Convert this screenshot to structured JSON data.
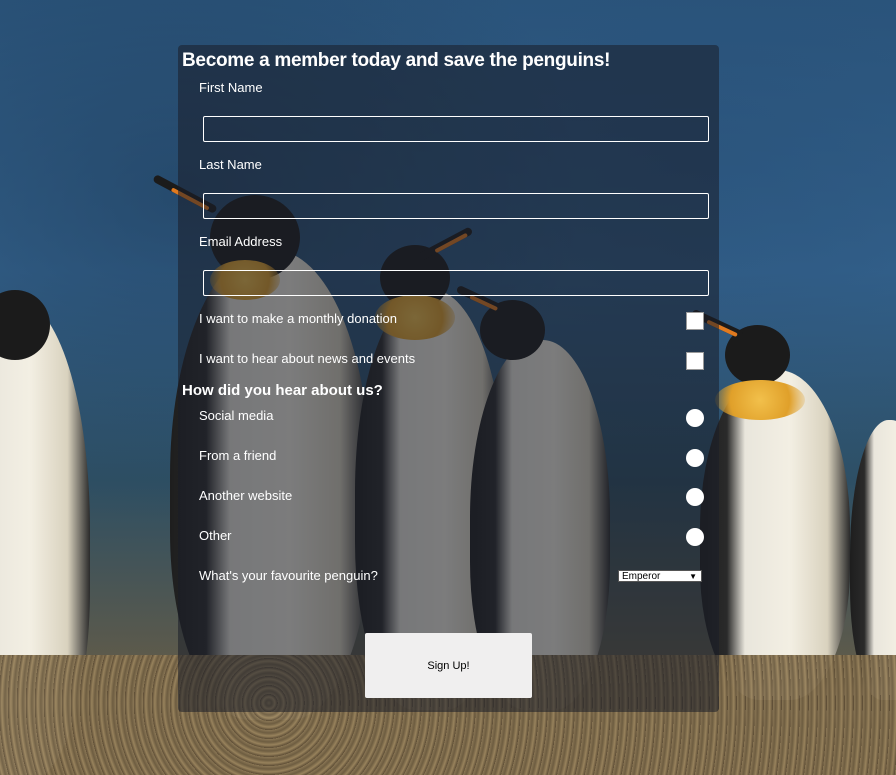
{
  "form": {
    "title": "Become a member today and save the penguins!",
    "first_name_label": "First Name",
    "first_name_value": "",
    "last_name_label": "Last Name",
    "last_name_value": "",
    "email_label": "Email Address",
    "email_value": "",
    "donation_label": "I want to make a monthly donation",
    "news_label": "I want to hear about news and events",
    "hear_heading": "How did you hear about us?",
    "hear_options": [
      "Social media",
      "From a friend",
      "Another website",
      "Other"
    ],
    "favourite_label": "What's your favourite penguin?",
    "favourite_selected": "Emperor",
    "submit_label": "Sign Up!"
  },
  "icons": {
    "select_arrow": "chevron-down-icon"
  }
}
